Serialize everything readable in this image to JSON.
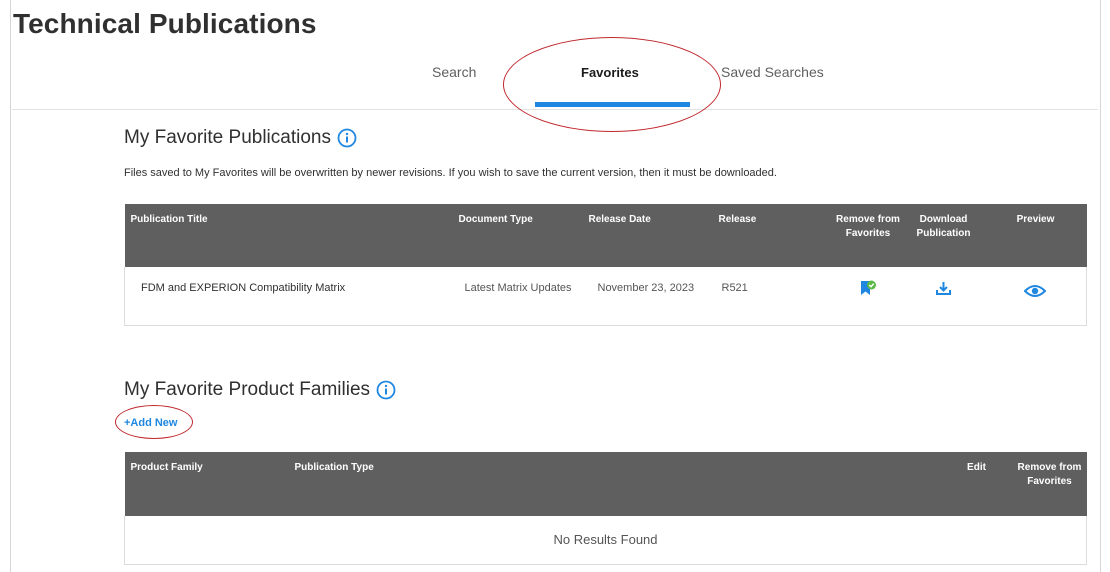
{
  "header": {
    "title": "Technical Publications"
  },
  "tabs": [
    {
      "label": "Search"
    },
    {
      "label": "Favorites"
    },
    {
      "label": "Saved Searches"
    }
  ],
  "publications": {
    "title": "My Favorite Publications",
    "note": "Files saved to My Favorites will be overwritten by newer revisions. If you wish to save the current version, then it must be downloaded.",
    "columns": [
      "Publication Title",
      "Document Type",
      "Release Date",
      "Release",
      "Remove from Favorites",
      "Download Publication",
      "Preview"
    ],
    "rows": [
      {
        "title": "FDM and EXPERION Compatibility Matrix",
        "doc_type": "Latest Matrix Updates",
        "release_date": "November 23, 2023",
        "release": "R521",
        "remove_icon": "bookmark-check-icon",
        "download_icon": "download-icon",
        "preview_icon": "eye-icon"
      }
    ]
  },
  "product_families": {
    "title": "My Favorite Product Families",
    "add_new_label": "+Add New",
    "columns": [
      "Product Family",
      "Publication Type",
      "Edit",
      "Remove from Favorites"
    ],
    "empty_text": "No Results Found"
  },
  "colors": {
    "accent": "#1f87e0",
    "header_bg": "#5f5f5f",
    "annotation": "#c0282d",
    "favorite_green": "#5ab947"
  }
}
